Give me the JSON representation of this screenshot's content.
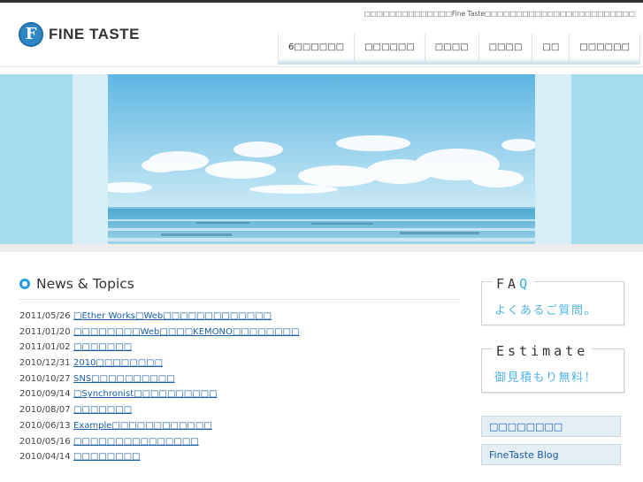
{
  "header": {
    "logo_mark": "F",
    "logo_text": "FINE TASTE",
    "tagline": "□□□□□□□□□□□□□□Fine Taste□□□□□□□□□□□□□□□□□□□□□□□□",
    "nav": [
      "6□□□□□□",
      "□□□□□□",
      "□□□□",
      "□□□□",
      "□□",
      "□□□□□□"
    ]
  },
  "news": {
    "title": "News & Topics",
    "items": [
      {
        "date": "2011/05/26",
        "text": "□Ether Works□Web□□□□□□□□□□□□□"
      },
      {
        "date": "2011/01/20",
        "text": "□□□□□□□□Web□□□□KEMONO□□□□□□□□"
      },
      {
        "date": "2011/01/02",
        "text": "□□□□□□□"
      },
      {
        "date": "2010/12/31",
        "text": "2010□□□□□□□□"
      },
      {
        "date": "2010/10/27",
        "text": "SNS□□□□□□□□□□"
      },
      {
        "date": "2010/09/14",
        "text": "□Synchronist□□□□□□□□□□"
      },
      {
        "date": "2010/08/07",
        "text": "□□□□□□□"
      },
      {
        "date": "2010/06/13",
        "text": "Example□□□□□□□□□□□□"
      },
      {
        "date": "2010/05/16",
        "text": "□□□□□□□□□□□□□□□"
      },
      {
        "date": "2010/04/14",
        "text": "□□□□□□□□"
      }
    ]
  },
  "sidebar": {
    "faq": {
      "title_main": "FA",
      "title_accent": "Q",
      "subtitle": "よくあるご質問。"
    },
    "estimate": {
      "title": "Estimate",
      "subtitle": "御見積もり無料！"
    },
    "links": [
      "□□□□□□□□",
      "FineTaste Blog"
    ]
  },
  "colors": {
    "accent": "#2a9ee0",
    "link": "#1a5ea8",
    "hero_sky": "#b7e1ef"
  }
}
